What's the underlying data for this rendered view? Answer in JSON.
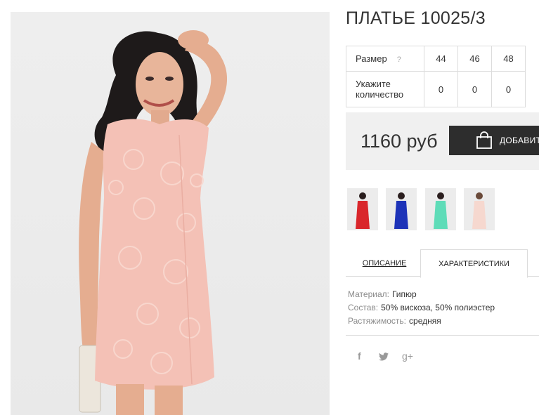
{
  "product": {
    "title": "ПЛАТЬЕ 10025/3"
  },
  "size_table": {
    "size_label": "Размер",
    "size_help": "?",
    "sizes": [
      "44",
      "46",
      "48"
    ],
    "qty_label": "Укажите количество",
    "quantities": [
      "0",
      "0",
      "0"
    ]
  },
  "purchase": {
    "price": "1160 руб",
    "add_button": "ДОБАВИТЬ"
  },
  "thumbnails": [
    {
      "color": "#d9262b"
    },
    {
      "color": "#1d33b8"
    },
    {
      "color": "#5fdcb8"
    },
    {
      "color": "#f6d8cf"
    }
  ],
  "tabs": {
    "description": "ОПИСАНИЕ",
    "characteristics": "ХАРАКТЕРИСТИКИ",
    "active": "characteristics"
  },
  "specs": [
    {
      "key": "Материал:",
      "value": "Гипюр"
    },
    {
      "key": "Состав:",
      "value": "50% вискоза, 50% полиэстер"
    },
    {
      "key": "Растяжимость:",
      "value": "средняя"
    }
  ],
  "social": {
    "facebook": "f",
    "twitter": "twitter-icon",
    "google_plus": "g+"
  },
  "colors": {
    "dress": "#f4c1b6",
    "button": "#2d2d2d",
    "price_bg": "#f0f0f0"
  }
}
